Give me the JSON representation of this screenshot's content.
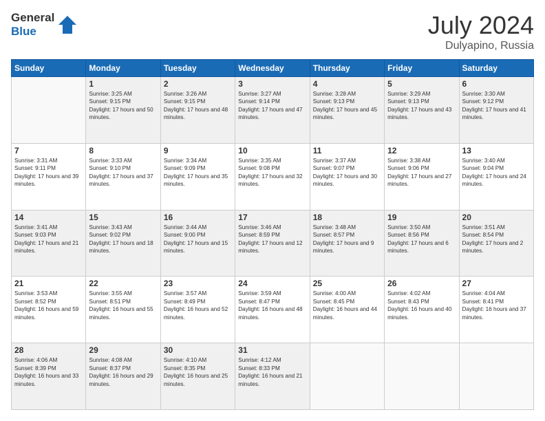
{
  "header": {
    "logo_general": "General",
    "logo_blue": "Blue",
    "month": "July 2024",
    "location": "Dulyapino, Russia"
  },
  "weekdays": [
    "Sunday",
    "Monday",
    "Tuesday",
    "Wednesday",
    "Thursday",
    "Friday",
    "Saturday"
  ],
  "weeks": [
    [
      {
        "day": "",
        "sunrise": "",
        "sunset": "",
        "daylight": ""
      },
      {
        "day": "1",
        "sunrise": "Sunrise: 3:25 AM",
        "sunset": "Sunset: 9:15 PM",
        "daylight": "Daylight: 17 hours and 50 minutes."
      },
      {
        "day": "2",
        "sunrise": "Sunrise: 3:26 AM",
        "sunset": "Sunset: 9:15 PM",
        "daylight": "Daylight: 17 hours and 48 minutes."
      },
      {
        "day": "3",
        "sunrise": "Sunrise: 3:27 AM",
        "sunset": "Sunset: 9:14 PM",
        "daylight": "Daylight: 17 hours and 47 minutes."
      },
      {
        "day": "4",
        "sunrise": "Sunrise: 3:28 AM",
        "sunset": "Sunset: 9:13 PM",
        "daylight": "Daylight: 17 hours and 45 minutes."
      },
      {
        "day": "5",
        "sunrise": "Sunrise: 3:29 AM",
        "sunset": "Sunset: 9:13 PM",
        "daylight": "Daylight: 17 hours and 43 minutes."
      },
      {
        "day": "6",
        "sunrise": "Sunrise: 3:30 AM",
        "sunset": "Sunset: 9:12 PM",
        "daylight": "Daylight: 17 hours and 41 minutes."
      }
    ],
    [
      {
        "day": "7",
        "sunrise": "Sunrise: 3:31 AM",
        "sunset": "Sunset: 9:11 PM",
        "daylight": "Daylight: 17 hours and 39 minutes."
      },
      {
        "day": "8",
        "sunrise": "Sunrise: 3:33 AM",
        "sunset": "Sunset: 9:10 PM",
        "daylight": "Daylight: 17 hours and 37 minutes."
      },
      {
        "day": "9",
        "sunrise": "Sunrise: 3:34 AM",
        "sunset": "Sunset: 9:09 PM",
        "daylight": "Daylight: 17 hours and 35 minutes."
      },
      {
        "day": "10",
        "sunrise": "Sunrise: 3:35 AM",
        "sunset": "Sunset: 9:08 PM",
        "daylight": "Daylight: 17 hours and 32 minutes."
      },
      {
        "day": "11",
        "sunrise": "Sunrise: 3:37 AM",
        "sunset": "Sunset: 9:07 PM",
        "daylight": "Daylight: 17 hours and 30 minutes."
      },
      {
        "day": "12",
        "sunrise": "Sunrise: 3:38 AM",
        "sunset": "Sunset: 9:06 PM",
        "daylight": "Daylight: 17 hours and 27 minutes."
      },
      {
        "day": "13",
        "sunrise": "Sunrise: 3:40 AM",
        "sunset": "Sunset: 9:04 PM",
        "daylight": "Daylight: 17 hours and 24 minutes."
      }
    ],
    [
      {
        "day": "14",
        "sunrise": "Sunrise: 3:41 AM",
        "sunset": "Sunset: 9:03 PM",
        "daylight": "Daylight: 17 hours and 21 minutes."
      },
      {
        "day": "15",
        "sunrise": "Sunrise: 3:43 AM",
        "sunset": "Sunset: 9:02 PM",
        "daylight": "Daylight: 17 hours and 18 minutes."
      },
      {
        "day": "16",
        "sunrise": "Sunrise: 3:44 AM",
        "sunset": "Sunset: 9:00 PM",
        "daylight": "Daylight: 17 hours and 15 minutes."
      },
      {
        "day": "17",
        "sunrise": "Sunrise: 3:46 AM",
        "sunset": "Sunset: 8:59 PM",
        "daylight": "Daylight: 17 hours and 12 minutes."
      },
      {
        "day": "18",
        "sunrise": "Sunrise: 3:48 AM",
        "sunset": "Sunset: 8:57 PM",
        "daylight": "Daylight: 17 hours and 9 minutes."
      },
      {
        "day": "19",
        "sunrise": "Sunrise: 3:50 AM",
        "sunset": "Sunset: 8:56 PM",
        "daylight": "Daylight: 17 hours and 6 minutes."
      },
      {
        "day": "20",
        "sunrise": "Sunrise: 3:51 AM",
        "sunset": "Sunset: 8:54 PM",
        "daylight": "Daylight: 17 hours and 2 minutes."
      }
    ],
    [
      {
        "day": "21",
        "sunrise": "Sunrise: 3:53 AM",
        "sunset": "Sunset: 8:52 PM",
        "daylight": "Daylight: 16 hours and 59 minutes."
      },
      {
        "day": "22",
        "sunrise": "Sunrise: 3:55 AM",
        "sunset": "Sunset: 8:51 PM",
        "daylight": "Daylight: 16 hours and 55 minutes."
      },
      {
        "day": "23",
        "sunrise": "Sunrise: 3:57 AM",
        "sunset": "Sunset: 8:49 PM",
        "daylight": "Daylight: 16 hours and 52 minutes."
      },
      {
        "day": "24",
        "sunrise": "Sunrise: 3:59 AM",
        "sunset": "Sunset: 8:47 PM",
        "daylight": "Daylight: 16 hours and 48 minutes."
      },
      {
        "day": "25",
        "sunrise": "Sunrise: 4:00 AM",
        "sunset": "Sunset: 8:45 PM",
        "daylight": "Daylight: 16 hours and 44 minutes."
      },
      {
        "day": "26",
        "sunrise": "Sunrise: 4:02 AM",
        "sunset": "Sunset: 8:43 PM",
        "daylight": "Daylight: 16 hours and 40 minutes."
      },
      {
        "day": "27",
        "sunrise": "Sunrise: 4:04 AM",
        "sunset": "Sunset: 8:41 PM",
        "daylight": "Daylight: 16 hours and 37 minutes."
      }
    ],
    [
      {
        "day": "28",
        "sunrise": "Sunrise: 4:06 AM",
        "sunset": "Sunset: 8:39 PM",
        "daylight": "Daylight: 16 hours and 33 minutes."
      },
      {
        "day": "29",
        "sunrise": "Sunrise: 4:08 AM",
        "sunset": "Sunset: 8:37 PM",
        "daylight": "Daylight: 16 hours and 29 minutes."
      },
      {
        "day": "30",
        "sunrise": "Sunrise: 4:10 AM",
        "sunset": "Sunset: 8:35 PM",
        "daylight": "Daylight: 16 hours and 25 minutes."
      },
      {
        "day": "31",
        "sunrise": "Sunrise: 4:12 AM",
        "sunset": "Sunset: 8:33 PM",
        "daylight": "Daylight: 16 hours and 21 minutes."
      },
      {
        "day": "",
        "sunrise": "",
        "sunset": "",
        "daylight": ""
      },
      {
        "day": "",
        "sunrise": "",
        "sunset": "",
        "daylight": ""
      },
      {
        "day": "",
        "sunrise": "",
        "sunset": "",
        "daylight": ""
      }
    ]
  ]
}
